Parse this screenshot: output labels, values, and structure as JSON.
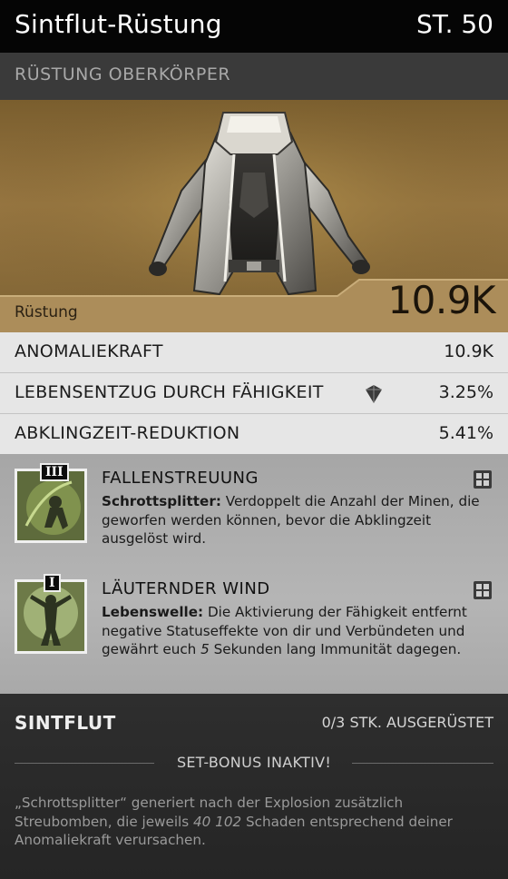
{
  "item": {
    "name": "Sintflut-Rüstung",
    "level": "ST. 50",
    "type": "RÜSTUNG OBERKÖRPER",
    "armor_label": "Rüstung",
    "armor_value": "10.9K"
  },
  "stats": [
    {
      "label": "ANOMALIEKRAFT",
      "value": "10.9K"
    },
    {
      "label": "LEBENSENTZUG DURCH FÄHIGKEIT",
      "value": "3.25%",
      "icon": "gem-icon"
    },
    {
      "label": "ABKLINGZEIT-REDUKTION",
      "value": "5.41%"
    }
  ],
  "perks": [
    {
      "tier": "III",
      "title": "FALLENSTREUUNG",
      "desc_bold": "Schrottsplitter:",
      "desc_text": " Verdoppelt die Anzahl der Minen, die geworfen werden können, bevor die Abklingzeit ausgelöst wird."
    },
    {
      "tier": "I",
      "title": "LÄUTERNDER WIND",
      "desc_bold": "Lebenswelle:",
      "desc_text_1": " Die Aktivierung der Fähigkeit entfernt negative Statuseffekte von dir und Verbündeten und gewährt euch ",
      "desc_em": "5",
      "desc_text_2": " Sekunden lang Immunität dagegen."
    }
  ],
  "set": {
    "name": "SINTFLUT",
    "count": "0/3 STK. AUSGERÜSTET",
    "bonus_status": "SET-BONUS INAKTIV!",
    "desc_1": "„Schrottsplitter“ generiert nach der Explosion zusätzlich Streubomben, die jeweils ",
    "desc_em": "40 102",
    "desc_2": " Schaden entsprechend deiner Anomaliekraft verursachen."
  },
  "colors": {
    "header_bg": "#050505",
    "hero_gold": "#977641",
    "stat_bg": "#e6e6e6",
    "perk_bg": "#b0b0b0",
    "set_bg": "#2b2b2b"
  }
}
